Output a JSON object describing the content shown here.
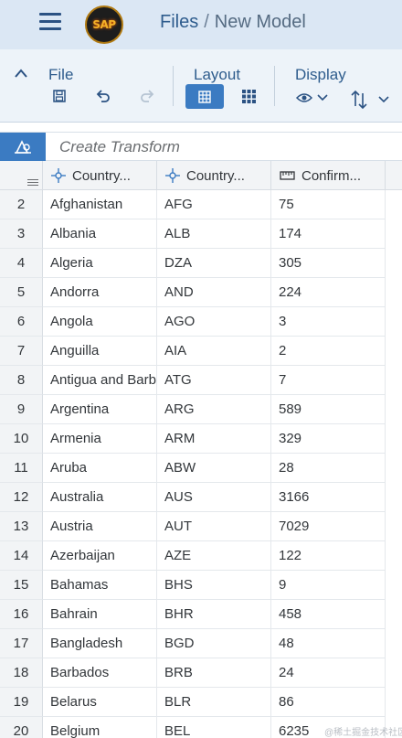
{
  "header": {
    "logo_text": "SAP",
    "breadcrumb_root": "Files",
    "breadcrumb_sep": "/",
    "breadcrumb_current": "New Model"
  },
  "toolbar": {
    "file_label": "File",
    "layout_label": "Layout",
    "display_label": "Display"
  },
  "transform": {
    "placeholder": "Create Transform"
  },
  "grid": {
    "columns": [
      "Country...",
      "Country...",
      "Confirm..."
    ],
    "rows": [
      {
        "n": "2",
        "c1": "Afghanistan",
        "c2": "AFG",
        "c3": "75"
      },
      {
        "n": "3",
        "c1": "Albania",
        "c2": "ALB",
        "c3": "174"
      },
      {
        "n": "4",
        "c1": "Algeria",
        "c2": "DZA",
        "c3": "305"
      },
      {
        "n": "5",
        "c1": "Andorra",
        "c2": "AND",
        "c3": "224"
      },
      {
        "n": "6",
        "c1": "Angola",
        "c2": "AGO",
        "c3": "3"
      },
      {
        "n": "7",
        "c1": "Anguilla",
        "c2": "AIA",
        "c3": "2"
      },
      {
        "n": "8",
        "c1": "Antigua and Barb",
        "c2": "ATG",
        "c3": "7"
      },
      {
        "n": "9",
        "c1": "Argentina",
        "c2": "ARG",
        "c3": "589"
      },
      {
        "n": "10",
        "c1": "Armenia",
        "c2": "ARM",
        "c3": "329"
      },
      {
        "n": "11",
        "c1": "Aruba",
        "c2": "ABW",
        "c3": "28"
      },
      {
        "n": "12",
        "c1": "Australia",
        "c2": "AUS",
        "c3": "3166"
      },
      {
        "n": "13",
        "c1": "Austria",
        "c2": "AUT",
        "c3": "7029"
      },
      {
        "n": "14",
        "c1": "Azerbaijan",
        "c2": "AZE",
        "c3": "122"
      },
      {
        "n": "15",
        "c1": "Bahamas",
        "c2": "BHS",
        "c3": "9"
      },
      {
        "n": "16",
        "c1": "Bahrain",
        "c2": "BHR",
        "c3": "458"
      },
      {
        "n": "17",
        "c1": "Bangladesh",
        "c2": "BGD",
        "c3": "48"
      },
      {
        "n": "18",
        "c1": "Barbados",
        "c2": "BRB",
        "c3": "24"
      },
      {
        "n": "19",
        "c1": "Belarus",
        "c2": "BLR",
        "c3": "86"
      },
      {
        "n": "20",
        "c1": "Belgium",
        "c2": "BEL",
        "c3": "6235"
      }
    ]
  },
  "watermark": "@稀土掘金技术社区",
  "colors": {
    "accent": "#3b7bc2",
    "topbar": "#dbe7f4",
    "toolbar": "#edf3f9"
  }
}
